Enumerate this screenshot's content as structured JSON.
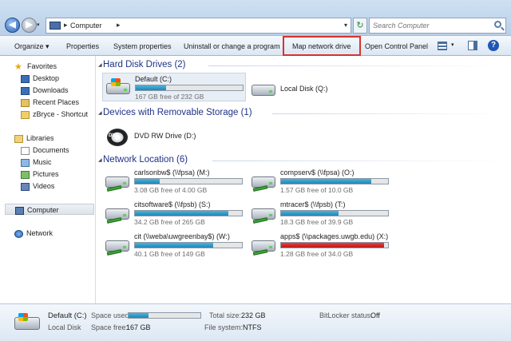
{
  "address": {
    "crumb_sep": "▸",
    "location": "Computer",
    "search_placeholder": "Search Computer"
  },
  "toolbar": {
    "organize": "Organize ▾",
    "properties": "Properties",
    "system_properties": "System properties",
    "uninstall": "Uninstall or change a program",
    "map_network_drive": "Map network drive",
    "open_control_panel": "Open Control Panel"
  },
  "nav": {
    "favorites": "Favorites",
    "desktop": "Desktop",
    "downloads": "Downloads",
    "recent_places": "Recent Places",
    "shortcut": "zBryce - Shortcut",
    "libraries": "Libraries",
    "documents": "Documents",
    "music": "Music",
    "pictures": "Pictures",
    "videos": "Videos",
    "computer": "Computer",
    "network": "Network"
  },
  "groups": {
    "hdd": "Hard Disk Drives (2)",
    "removable": "Devices with Removable Storage (1)",
    "network": "Network Location (6)"
  },
  "drives": {
    "c": {
      "name": "Default (C:)",
      "free": "167 GB free of 232 GB",
      "used_fraction": 0.28
    },
    "q": {
      "name": "Local Disk (Q:)"
    },
    "d": {
      "name": "DVD RW Drive (D:)"
    },
    "m": {
      "name": "carlsonbw$ (\\\\fpsa) (M:)",
      "free": "3.08 GB free of 4.00 GB",
      "used_fraction": 0.23
    },
    "o": {
      "name": "compserv$ (\\\\fpsa) (O:)",
      "free": "1.57 GB free of 10.0 GB",
      "used_fraction": 0.84
    },
    "s": {
      "name": "citsoftware$ (\\\\fpsb) (S:)",
      "free": "34.2 GB free of 265 GB",
      "used_fraction": 0.87
    },
    "t": {
      "name": "mtracer$ (\\\\fpsb) (T:)",
      "free": "18.3 GB free of 39.9 GB",
      "used_fraction": 0.54
    },
    "w": {
      "name": "cit (\\\\weba\\uwgreenbay$) (W:)",
      "free": "40.1 GB free of 149 GB",
      "used_fraction": 0.73
    },
    "x": {
      "name": "apps$ (\\\\packages.uwgb.edu) (X:)",
      "free": "1.28 GB free of 34.0 GB",
      "used_fraction": 0.96
    }
  },
  "details": {
    "name": "Default (C:)",
    "type": "Local Disk",
    "space_used_label": "Space used:",
    "space_free_label": "Space free:",
    "space_free": "167 GB",
    "total_size_label": "Total size:",
    "total_size": "232 GB",
    "file_system_label": "File system:",
    "file_system": "NTFS",
    "bitlocker_label": "BitLocker status:",
    "bitlocker": "Off"
  },
  "colors": {
    "accent": "#1e3287",
    "highlight_border": "#d8322e",
    "bar_fill": "#1f86b5",
    "bar_critical": "#c01616"
  }
}
